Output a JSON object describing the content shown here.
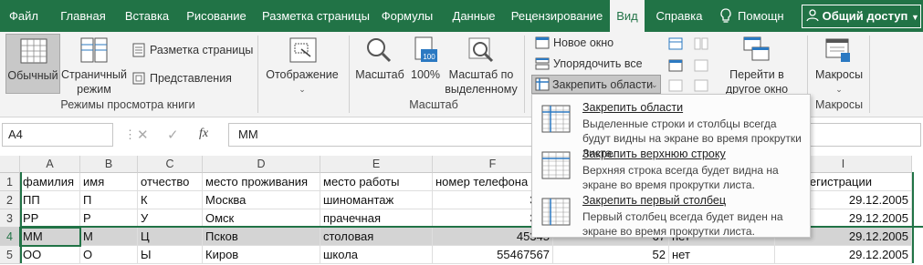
{
  "tabs": [
    "Файл",
    "Главная",
    "Вставка",
    "Рисование",
    "Разметка страницы",
    "Формулы",
    "Данные",
    "Рецензирование",
    "Вид",
    "Справка",
    "Помощн"
  ],
  "share_label": "Общий доступ",
  "ribbon": {
    "normal": "Обычный",
    "page_mode": [
      "Страничный",
      "режим"
    ],
    "page_layout": "Разметка страницы",
    "views": "Представления",
    "group_book_views": "Режимы просмотра книги",
    "show": "Отображение",
    "zoom": "Масштаб",
    "zoom100": "100%",
    "zoom_sel": [
      "Масштаб по",
      "выделенному"
    ],
    "group_zoom": "Масштаб",
    "new_window": "Новое окно",
    "arrange_all": "Упорядочить все",
    "freeze_panes": "Закрепить области",
    "switch_windows": [
      "Перейти в",
      "другое окно"
    ],
    "macros": "Макросы",
    "group_macros": "Макросы"
  },
  "formula": {
    "name_box": "A4",
    "fx": "fx",
    "value": "ММ"
  },
  "columns": [
    "A",
    "B",
    "C",
    "D",
    "E",
    "F",
    "G",
    "H",
    "I"
  ],
  "rows": [
    {
      "n": "1",
      "cells": [
        "фамилия",
        "имя",
        "отчество",
        "место проживания",
        "место работы",
        "номер телефона",
        "",
        "",
        "ка о регистрации"
      ]
    },
    {
      "n": "2",
      "cells": [
        "ПП",
        "П",
        "К",
        "Москва",
        "шиномантаж",
        "342",
        "",
        "",
        "29.12.2005"
      ]
    },
    {
      "n": "3",
      "cells": [
        "РР",
        "Р",
        "У",
        "Омск",
        "прачечная",
        "345",
        "",
        "",
        "29.12.2005"
      ]
    },
    {
      "n": "4",
      "cells": [
        "ММ",
        "М",
        "Ц",
        "Псков",
        "столовая",
        "45345",
        "67",
        "нет",
        "29.12.2005"
      ]
    },
    {
      "n": "5",
      "cells": [
        "ОО",
        "О",
        "Ы",
        "Киров",
        "школа",
        "55467567",
        "52",
        "нет",
        "29.12.2005"
      ]
    }
  ],
  "dropdown": [
    {
      "title": "Закрепить области",
      "desc": "Выделенные строки и столбцы всегда будут видны на экране во время прокрутки листа."
    },
    {
      "title": "Закрепить верхнюю строку",
      "desc": "Верхняя строка всегда будет видна на экране во время прокрутки листа."
    },
    {
      "title": "Закрепить первый столбец",
      "desc": "Первый столбец всегда будет виден на экране во время прокрутки листа."
    }
  ]
}
